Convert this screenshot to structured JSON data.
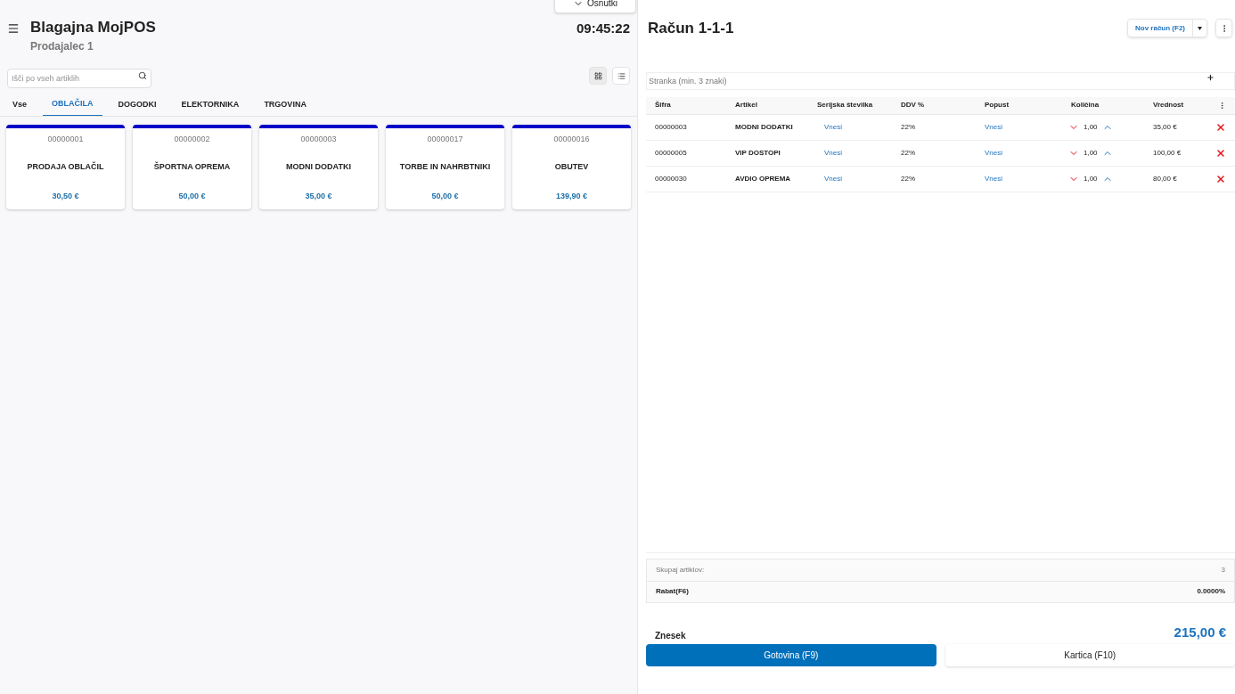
{
  "drafts_button": {
    "label": "Osnutki"
  },
  "header": {
    "title": "Blagajna MojPOS",
    "subtitle": "Prodajalec 1",
    "clock": "09:45:22"
  },
  "search": {
    "placeholder": "Išči po vseh artiklih"
  },
  "view_toggle": [
    {
      "kind": "grid",
      "selected": true
    },
    {
      "kind": "list",
      "selected": false
    }
  ],
  "tabs": [
    {
      "label": "Vse",
      "selected": false
    },
    {
      "label": "OBLAČILA",
      "selected": true
    },
    {
      "label": "DOGODKI",
      "selected": false
    },
    {
      "label": "ELEKTORNIKA",
      "selected": false
    },
    {
      "label": "TRGOVINA",
      "selected": false
    }
  ],
  "products": [
    {
      "code": "00000001",
      "name": "PRODAJA OBLAČIL",
      "price": "30,50 €"
    },
    {
      "code": "00000002",
      "name": "ŠPORTNA OPREMA",
      "price": "50,00 €"
    },
    {
      "code": "00000003",
      "name": "MODNI DODATKI",
      "price": "35,00 €"
    },
    {
      "code": "00000017",
      "name": "TORBE IN NAHRBTNIKI",
      "price": "50,00 €"
    },
    {
      "code": "00000016",
      "name": "OBUTEV",
      "price": "139,90 €"
    }
  ],
  "receipt": {
    "title": "Račun 1-1-1",
    "new_button": "Nov račun (F2)",
    "customer": {
      "placeholder": "Stranka (min. 3 znaki)"
    },
    "columns": [
      "Šifra",
      "Artikel",
      "Serijska številka",
      "DDV %",
      "Popust",
      "Količina",
      "Vrednost"
    ],
    "rows": [
      {
        "code": "00000003",
        "name": "MODNI DODATKI",
        "serial": "Vnesi",
        "vat": "22%",
        "discount": "Vnesi",
        "qty": "1,00",
        "value": "35,00 €"
      },
      {
        "code": "00000005",
        "name": "VIP DOSTOPI",
        "serial": "Vnesi",
        "vat": "22%",
        "discount": "Vnesi",
        "qty": "1,00",
        "value": "100,00 €"
      },
      {
        "code": "00000030",
        "name": "AVDIO OPREMA",
        "serial": "Vnesi",
        "vat": "22%",
        "discount": "Vnesi",
        "qty": "1,00",
        "value": "80,00 €"
      }
    ],
    "summary": [
      {
        "label": "Skupaj artiklov:",
        "value": "3",
        "bold": false
      },
      {
        "label": "Rabat(F6)",
        "value": "0.0000%",
        "bold": true
      }
    ],
    "total_label": "Znesek",
    "total": "215,00 €",
    "pay_buttons": [
      {
        "label": "Gotovina (F9)",
        "primary": true
      },
      {
        "label": "Kartica (F10)",
        "primary": false
      }
    ]
  }
}
